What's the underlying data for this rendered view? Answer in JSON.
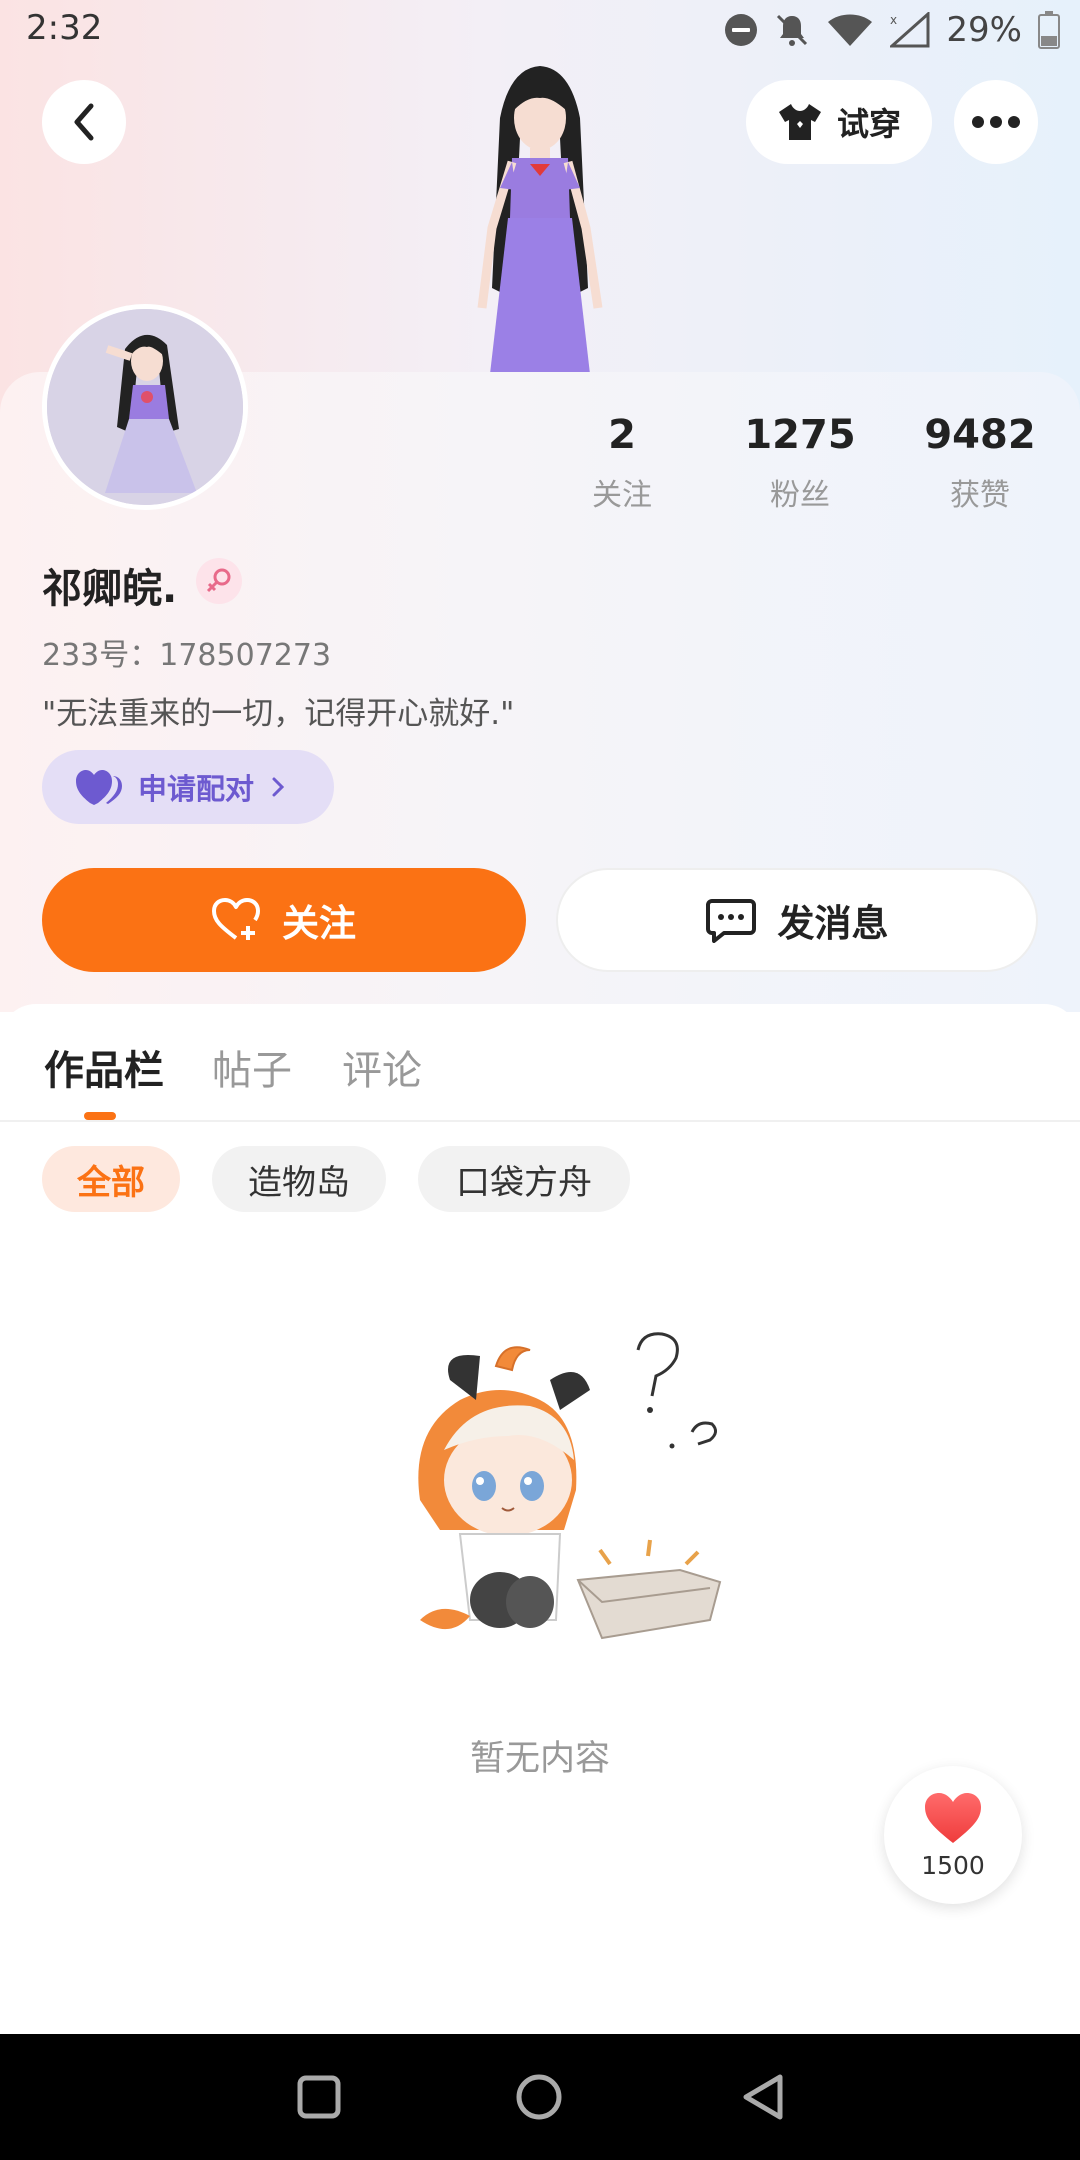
{
  "status_bar": {
    "time": "2:32",
    "battery_text": "29%",
    "icons": [
      "do-not-disturb-icon",
      "bell-off-icon",
      "wifi-icon",
      "signal-icon",
      "battery-icon"
    ]
  },
  "header": {
    "tryon_label": "试穿",
    "icons": [
      "back-icon",
      "shirt-icon",
      "more-icon"
    ]
  },
  "profile": {
    "name": "祁卿皖.",
    "gender": "female",
    "id_text": "233号：178507273",
    "bio": "\"无法重来的一切，记得开心就好.\"",
    "pair_label": "申请配对",
    "stats": [
      {
        "value": "2",
        "label": "关注"
      },
      {
        "value": "1275",
        "label": "粉丝"
      },
      {
        "value": "9482",
        "label": "获赞"
      }
    ]
  },
  "actions": {
    "follow_label": "关注",
    "message_label": "发消息"
  },
  "tabs": [
    {
      "label": "作品栏",
      "active": true
    },
    {
      "label": "帖子",
      "active": false
    },
    {
      "label": "评论",
      "active": false
    }
  ],
  "filters": [
    {
      "label": "全部",
      "active": true
    },
    {
      "label": "造物岛",
      "active": false
    },
    {
      "label": "口袋方舟",
      "active": false
    }
  ],
  "empty_state": {
    "text": "暂无内容"
  },
  "like_float": {
    "count": "1500"
  },
  "colors": {
    "accent": "#fb7214",
    "pair_purple": "#6d5ad0",
    "pair_bg": "#e4def6"
  }
}
